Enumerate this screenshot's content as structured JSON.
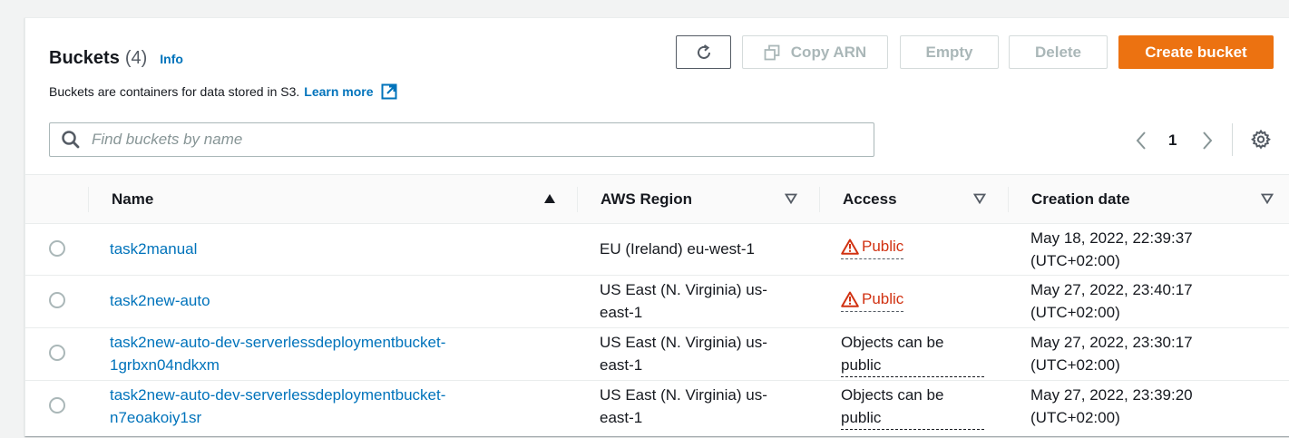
{
  "header": {
    "title": "Buckets",
    "count": "(4)",
    "info": "Info",
    "description": "Buckets are containers for data stored in S3.",
    "learn_more": "Learn more"
  },
  "toolbar": {
    "copy_arn": "Copy ARN",
    "empty": "Empty",
    "delete": "Delete",
    "create_bucket": "Create bucket"
  },
  "search": {
    "placeholder": "Find buckets by name",
    "value": ""
  },
  "pagination": {
    "current_page": "1"
  },
  "table": {
    "columns": [
      "Name",
      "AWS Region",
      "Access",
      "Creation date"
    ],
    "sorted_column": "Name",
    "rows": [
      {
        "name": [
          "task2manual"
        ],
        "region": [
          "EU (Ireland) eu-west-1"
        ],
        "access": "Public",
        "access_type": "public",
        "date": [
          "May 18, 2022, 22:39:37",
          "(UTC+02:00)"
        ]
      },
      {
        "name": [
          "task2new-auto"
        ],
        "region": [
          "US East (N. Virginia) us-",
          "east-1"
        ],
        "access": "Public",
        "access_type": "public",
        "date": [
          "May 27, 2022, 23:40:17",
          "(UTC+02:00)"
        ]
      },
      {
        "name": [
          "task2new-auto-dev-serverlessdeploymentbucket-",
          "1grbxn04ndkxm"
        ],
        "region": [
          "US East (N. Virginia) us-",
          "east-1"
        ],
        "access": [
          "Objects can be",
          "public"
        ],
        "access_type": "objects",
        "date": [
          "May 27, 2022, 23:30:17",
          "(UTC+02:00)"
        ]
      },
      {
        "name": [
          "task2new-auto-dev-serverlessdeploymentbucket-",
          "n7eoakoiy1sr"
        ],
        "region": [
          "US East (N. Virginia) us-",
          "east-1"
        ],
        "access": [
          "Objects can be",
          "public"
        ],
        "access_type": "objects",
        "date": [
          "May 27, 2022, 23:39:20",
          "(UTC+02:00)"
        ]
      }
    ]
  },
  "colors": {
    "primary_button": "#ec7211",
    "link": "#0073bb",
    "warning": "#d13212",
    "disabled_text": "#aab7b8"
  },
  "icons": [
    "refresh-icon",
    "copy-icon",
    "external-link-icon",
    "search-icon",
    "chevron-left-icon",
    "chevron-right-icon",
    "settings-gear-icon",
    "sort-ascending-icon",
    "sort-descending-icon",
    "warning-icon"
  ]
}
